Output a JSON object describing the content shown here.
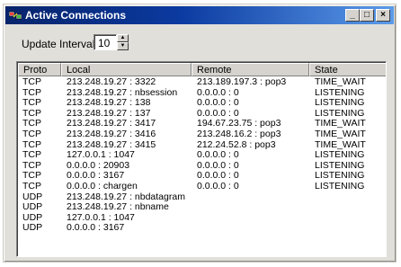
{
  "window": {
    "title": "Active Connections",
    "buttons": {
      "minimize": "_",
      "maximize": "□",
      "close": "×"
    }
  },
  "interval": {
    "label": "Update Interval:",
    "value": "10",
    "up": "▲",
    "down": "▼"
  },
  "table": {
    "columns": [
      "Proto",
      "Local",
      "Remote",
      "State"
    ],
    "rows": [
      [
        "TCP",
        "213.248.19.27 : 3322",
        "213.189.197.3 : pop3",
        "TIME_WAIT"
      ],
      [
        "TCP",
        "213.248.19.27 : nbsession",
        "0.0.0.0 : 0",
        "LISTENING"
      ],
      [
        "TCP",
        "213.248.19.27 : 138",
        "0.0.0.0 : 0",
        "LISTENING"
      ],
      [
        "TCP",
        "213.248.19.27 : 137",
        "0.0.0.0 : 0",
        "LISTENING"
      ],
      [
        "TCP",
        "213.248.19.27 : 3417",
        "194.67.23.75 : pop3",
        "TIME_WAIT"
      ],
      [
        "TCP",
        "213.248.19.27 : 3416",
        "213.248.16.2 : pop3",
        "TIME_WAIT"
      ],
      [
        "TCP",
        "213.248.19.27 : 3415",
        "212.24.52.8 : pop3",
        "TIME_WAIT"
      ],
      [
        "TCP",
        "127.0.0.1 : 1047",
        "0.0.0.0 : 0",
        "LISTENING"
      ],
      [
        "TCP",
        "0.0.0.0 : 20903",
        "0.0.0.0 : 0",
        "LISTENING"
      ],
      [
        "TCP",
        "0.0.0.0 : 3167",
        "0.0.0.0 : 0",
        "LISTENING"
      ],
      [
        "TCP",
        "0.0.0.0 : chargen",
        "0.0.0.0 : 0",
        "LISTENING"
      ],
      [
        "UDP",
        "213.248.19.27 : nbdatagram",
        "",
        ""
      ],
      [
        "UDP",
        "213.248.19.27 : nbname",
        "",
        ""
      ],
      [
        "UDP",
        "127.0.0.1 : 1047",
        "",
        ""
      ],
      [
        "UDP",
        "0.0.0.0 : 3167",
        "",
        ""
      ]
    ]
  },
  "colors": {
    "titlebar_start": "#08246b",
    "titlebar_end": "#5b9bea",
    "window_bg": "#e1dfda"
  }
}
